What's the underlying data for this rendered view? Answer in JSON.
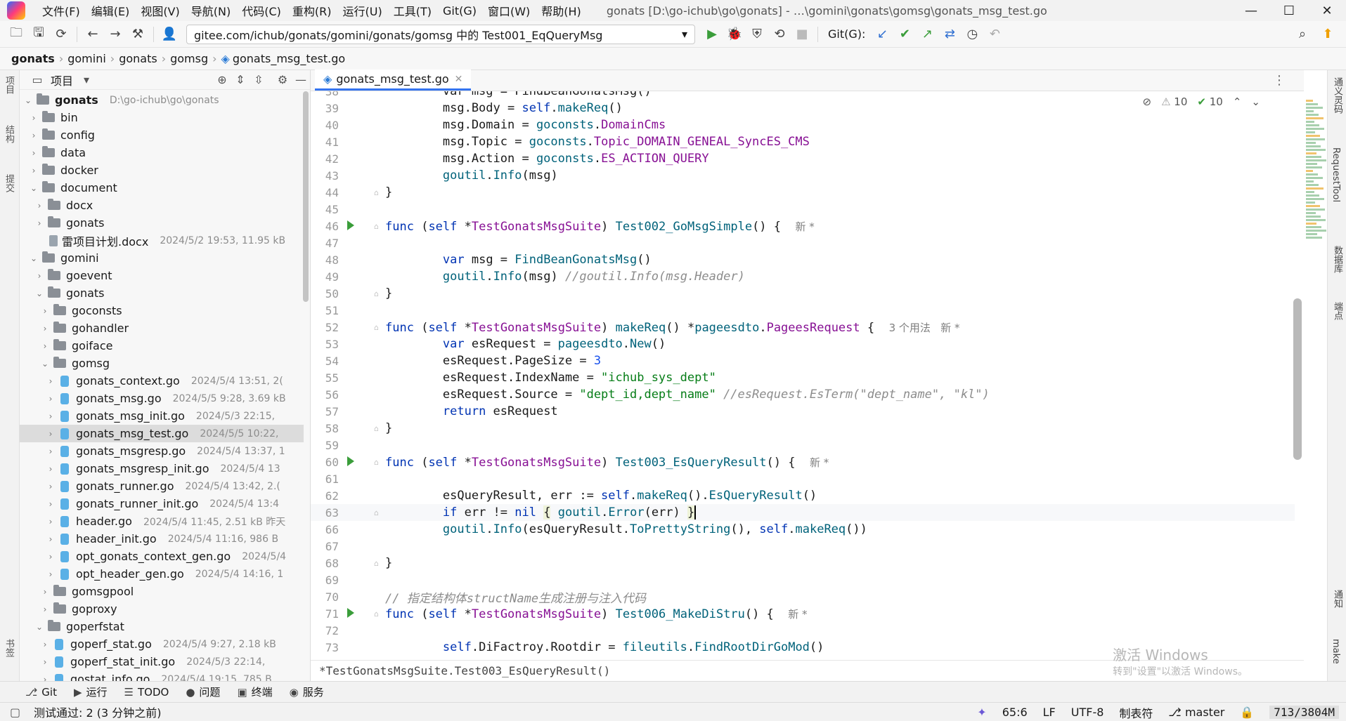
{
  "titlebar": {
    "menus": [
      "文件(F)",
      "编辑(E)",
      "视图(V)",
      "导航(N)",
      "代码(C)",
      "重构(R)",
      "运行(U)",
      "工具(T)",
      "Git(G)",
      "窗口(W)",
      "帮助(H)"
    ],
    "window_title": "gonats [D:\\go-ichub\\go\\gonats] - …\\gomini\\gonats\\gomsg\\gonats_msg_test.go",
    "controls": {
      "minimize": "—",
      "maximize": "☐",
      "close": "✕"
    }
  },
  "toolbar": {
    "run_config": "gitee.com/ichub/gonats/gomini/gonats/gomsg 中的 Test001_EqQueryMsg",
    "git_label": "Git(G):"
  },
  "breadcrumb": [
    "gonats",
    "gomini",
    "gonats",
    "gomsg",
    "gonats_msg_test.go"
  ],
  "left_strip": {
    "project": "项目",
    "structure": "结构",
    "commit": "提交",
    "bookmarks": "书签"
  },
  "project_panel": {
    "title": "项目",
    "tree": [
      {
        "indent": 0,
        "chev": "v",
        "kind": "folder",
        "name": "gonats",
        "meta": "D:\\go-ichub\\go\\gonats",
        "bold": true
      },
      {
        "indent": 1,
        "chev": ">",
        "kind": "folder",
        "name": "bin",
        "meta": ""
      },
      {
        "indent": 1,
        "chev": ">",
        "kind": "folder",
        "name": "config",
        "meta": ""
      },
      {
        "indent": 1,
        "chev": ">",
        "kind": "folder",
        "name": "data",
        "meta": ""
      },
      {
        "indent": 1,
        "chev": ">",
        "kind": "folder",
        "name": "docker",
        "meta": ""
      },
      {
        "indent": 1,
        "chev": "v",
        "kind": "folder",
        "name": "document",
        "meta": ""
      },
      {
        "indent": 2,
        "chev": ">",
        "kind": "folder",
        "name": "docx",
        "meta": ""
      },
      {
        "indent": 2,
        "chev": ">",
        "kind": "folder",
        "name": "gonats",
        "meta": ""
      },
      {
        "indent": 2,
        "chev": "",
        "kind": "doc",
        "name": "雷项目计划.docx",
        "meta": "2024/5/2 19:53, 11.95 kB"
      },
      {
        "indent": 1,
        "chev": "v",
        "kind": "folder",
        "name": "gomini",
        "meta": ""
      },
      {
        "indent": 2,
        "chev": ">",
        "kind": "folder",
        "name": "goevent",
        "meta": ""
      },
      {
        "indent": 2,
        "chev": "v",
        "kind": "folder",
        "name": "gonats",
        "meta": ""
      },
      {
        "indent": 3,
        "chev": ">",
        "kind": "folder",
        "name": "goconsts",
        "meta": ""
      },
      {
        "indent": 3,
        "chev": ">",
        "kind": "folder",
        "name": "gohandler",
        "meta": ""
      },
      {
        "indent": 3,
        "chev": ">",
        "kind": "folder",
        "name": "goiface",
        "meta": ""
      },
      {
        "indent": 3,
        "chev": "v",
        "kind": "folder",
        "name": "gomsg",
        "meta": ""
      },
      {
        "indent": 4,
        "chev": ">",
        "kind": "go",
        "name": "gonats_context.go",
        "meta": "2024/5/4 13:51, 2("
      },
      {
        "indent": 4,
        "chev": ">",
        "kind": "go",
        "name": "gonats_msg.go",
        "meta": "2024/5/5 9:28, 3.69 kB"
      },
      {
        "indent": 4,
        "chev": ">",
        "kind": "go",
        "name": "gonats_msg_init.go",
        "meta": "2024/5/3 22:15,"
      },
      {
        "indent": 4,
        "chev": ">",
        "kind": "go",
        "name": "gonats_msg_test.go",
        "meta": "2024/5/5 10:22,",
        "selected": true
      },
      {
        "indent": 4,
        "chev": ">",
        "kind": "go",
        "name": "gonats_msgresp.go",
        "meta": "2024/5/4 13:37, 1"
      },
      {
        "indent": 4,
        "chev": ">",
        "kind": "go",
        "name": "gonats_msgresp_init.go",
        "meta": "2024/5/4 13"
      },
      {
        "indent": 4,
        "chev": ">",
        "kind": "go",
        "name": "gonats_runner.go",
        "meta": "2024/5/4 13:42, 2.("
      },
      {
        "indent": 4,
        "chev": ">",
        "kind": "go",
        "name": "gonats_runner_init.go",
        "meta": "2024/5/4 13:4"
      },
      {
        "indent": 4,
        "chev": ">",
        "kind": "go",
        "name": "header.go",
        "meta": "2024/5/4 11:45, 2.51 kB 昨天"
      },
      {
        "indent": 4,
        "chev": ">",
        "kind": "go",
        "name": "header_init.go",
        "meta": "2024/5/4 11:16, 986 B"
      },
      {
        "indent": 4,
        "chev": ">",
        "kind": "go",
        "name": "opt_gonats_context_gen.go",
        "meta": "2024/5/4"
      },
      {
        "indent": 4,
        "chev": ">",
        "kind": "go",
        "name": "opt_header_gen.go",
        "meta": "2024/5/4 14:16, 1"
      },
      {
        "indent": 3,
        "chev": ">",
        "kind": "folder",
        "name": "gomsgpool",
        "meta": ""
      },
      {
        "indent": 3,
        "chev": ">",
        "kind": "folder",
        "name": "goproxy",
        "meta": ""
      },
      {
        "indent": 2,
        "chev": "v",
        "kind": "folder",
        "name": "goperfstat",
        "meta": ""
      },
      {
        "indent": 3,
        "chev": ">",
        "kind": "go",
        "name": "goperf_stat.go",
        "meta": "2024/5/4 9:27, 2.18 kB"
      },
      {
        "indent": 3,
        "chev": ">",
        "kind": "go",
        "name": "goperf_stat_init.go",
        "meta": "2024/5/3 22:14,"
      },
      {
        "indent": 3,
        "chev": ">",
        "kind": "go",
        "name": "gostat_info.go",
        "meta": "2024/5/4 19:15, 785 B"
      }
    ]
  },
  "editor": {
    "tab_name": "gonats_msg_test.go",
    "warnings": "10",
    "checks": "10",
    "bottom_breadcrumb": "*TestGonatsMsgSuite.Test003_EsQueryResult()",
    "watermark_title": "激活 Windows",
    "watermark_sub": "转到\"设置\"以激活 Windows。"
  },
  "right_strip": {
    "notifications_tool": "通义灵码",
    "request_tool": "RequestTool",
    "database": "数据库",
    "endpoints": "端点",
    "notifications": "通知",
    "make": "make"
  },
  "bottom_tabs": [
    {
      "icon": "⎇",
      "label": "Git"
    },
    {
      "icon": "▶",
      "label": "运行"
    },
    {
      "icon": "☰",
      "label": "TODO"
    },
    {
      "icon": "●",
      "label": "问题"
    },
    {
      "icon": "▣",
      "label": "终端"
    },
    {
      "icon": "◉",
      "label": "服务"
    }
  ],
  "statusbar": {
    "message": "测试通过: 2 (3 分钟之前)",
    "position": "65:6",
    "line_sep": "LF",
    "encoding": "UTF-8",
    "indent": "制表符",
    "branch": "master",
    "memory": "713/3804M"
  }
}
